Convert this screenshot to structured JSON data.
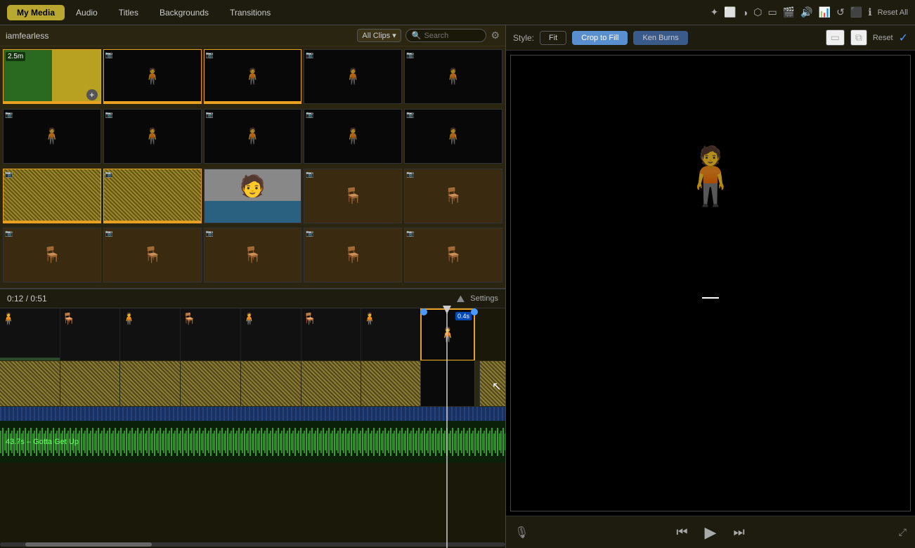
{
  "topNav": {
    "tabs": [
      {
        "id": "my-media",
        "label": "My Media",
        "active": true
      },
      {
        "id": "audio",
        "label": "Audio",
        "active": false
      },
      {
        "id": "titles",
        "label": "Titles",
        "active": false
      },
      {
        "id": "backgrounds",
        "label": "Backgrounds",
        "active": false
      },
      {
        "id": "transitions",
        "label": "Transitions",
        "active": false
      }
    ],
    "icons": [
      "✦",
      "⬜",
      "◑",
      "⬡",
      "▭",
      "🎬",
      "🔊",
      "📊",
      "↺",
      "⬛",
      "ℹ"
    ],
    "resetAll": "Reset All"
  },
  "libraryHeader": {
    "title": "iamfearless",
    "clipsFilter": "All Clips ▾",
    "searchPlaceholder": "Search"
  },
  "styleBar": {
    "label": "Style:",
    "buttons": [
      {
        "id": "fit",
        "label": "Fit",
        "active": false
      },
      {
        "id": "crop-to-fill",
        "label": "Crop to Fill",
        "active": true
      },
      {
        "id": "ken-burns",
        "label": "Ken Burns",
        "active": false
      }
    ],
    "icons": [
      "▭",
      "▭"
    ],
    "reset": "Reset"
  },
  "timecode": {
    "current": "0:12",
    "total": "0:51",
    "separator": "/"
  },
  "timeline": {
    "settings": "Settings",
    "playheadPosition": 635,
    "speedBadge": "0.4s",
    "musicLabel": "43.7s – Gotta Get Up"
  },
  "thumbnails": {
    "row1": [
      {
        "type": "split-green-yellow",
        "duration": "2.5m",
        "selected": true
      },
      {
        "type": "dark-figure",
        "cam": true,
        "orange": true
      },
      {
        "type": "dark-figure",
        "cam": true,
        "orange": true
      },
      {
        "type": "dark-figure",
        "cam": true,
        "orange": false
      },
      {
        "type": "dark-figure",
        "cam": true,
        "orange": false
      }
    ],
    "row2": [
      {
        "type": "dark-figure",
        "cam": true,
        "orange": false
      },
      {
        "type": "dark-figure",
        "cam": true,
        "orange": false
      },
      {
        "type": "dark-figure",
        "cam": true,
        "orange": false
      },
      {
        "type": "dark-figure",
        "cam": true,
        "orange": false
      },
      {
        "type": "dark-figure",
        "cam": true,
        "orange": false
      }
    ],
    "row3": [
      {
        "type": "noise",
        "cam": true,
        "orange": true
      },
      {
        "type": "noise",
        "cam": true,
        "orange": true
      },
      {
        "type": "person-light",
        "cam": false,
        "orange": false
      },
      {
        "type": "chair",
        "cam": true,
        "orange": false
      },
      {
        "type": "chair",
        "cam": true,
        "orange": false
      }
    ],
    "row4": [
      {
        "type": "chair",
        "cam": true,
        "orange": false
      },
      {
        "type": "chair",
        "cam": true,
        "orange": false
      },
      {
        "type": "chair",
        "cam": true,
        "orange": false
      },
      {
        "type": "chair",
        "cam": true,
        "orange": false
      },
      {
        "type": "chair",
        "cam": true,
        "orange": false
      }
    ]
  }
}
